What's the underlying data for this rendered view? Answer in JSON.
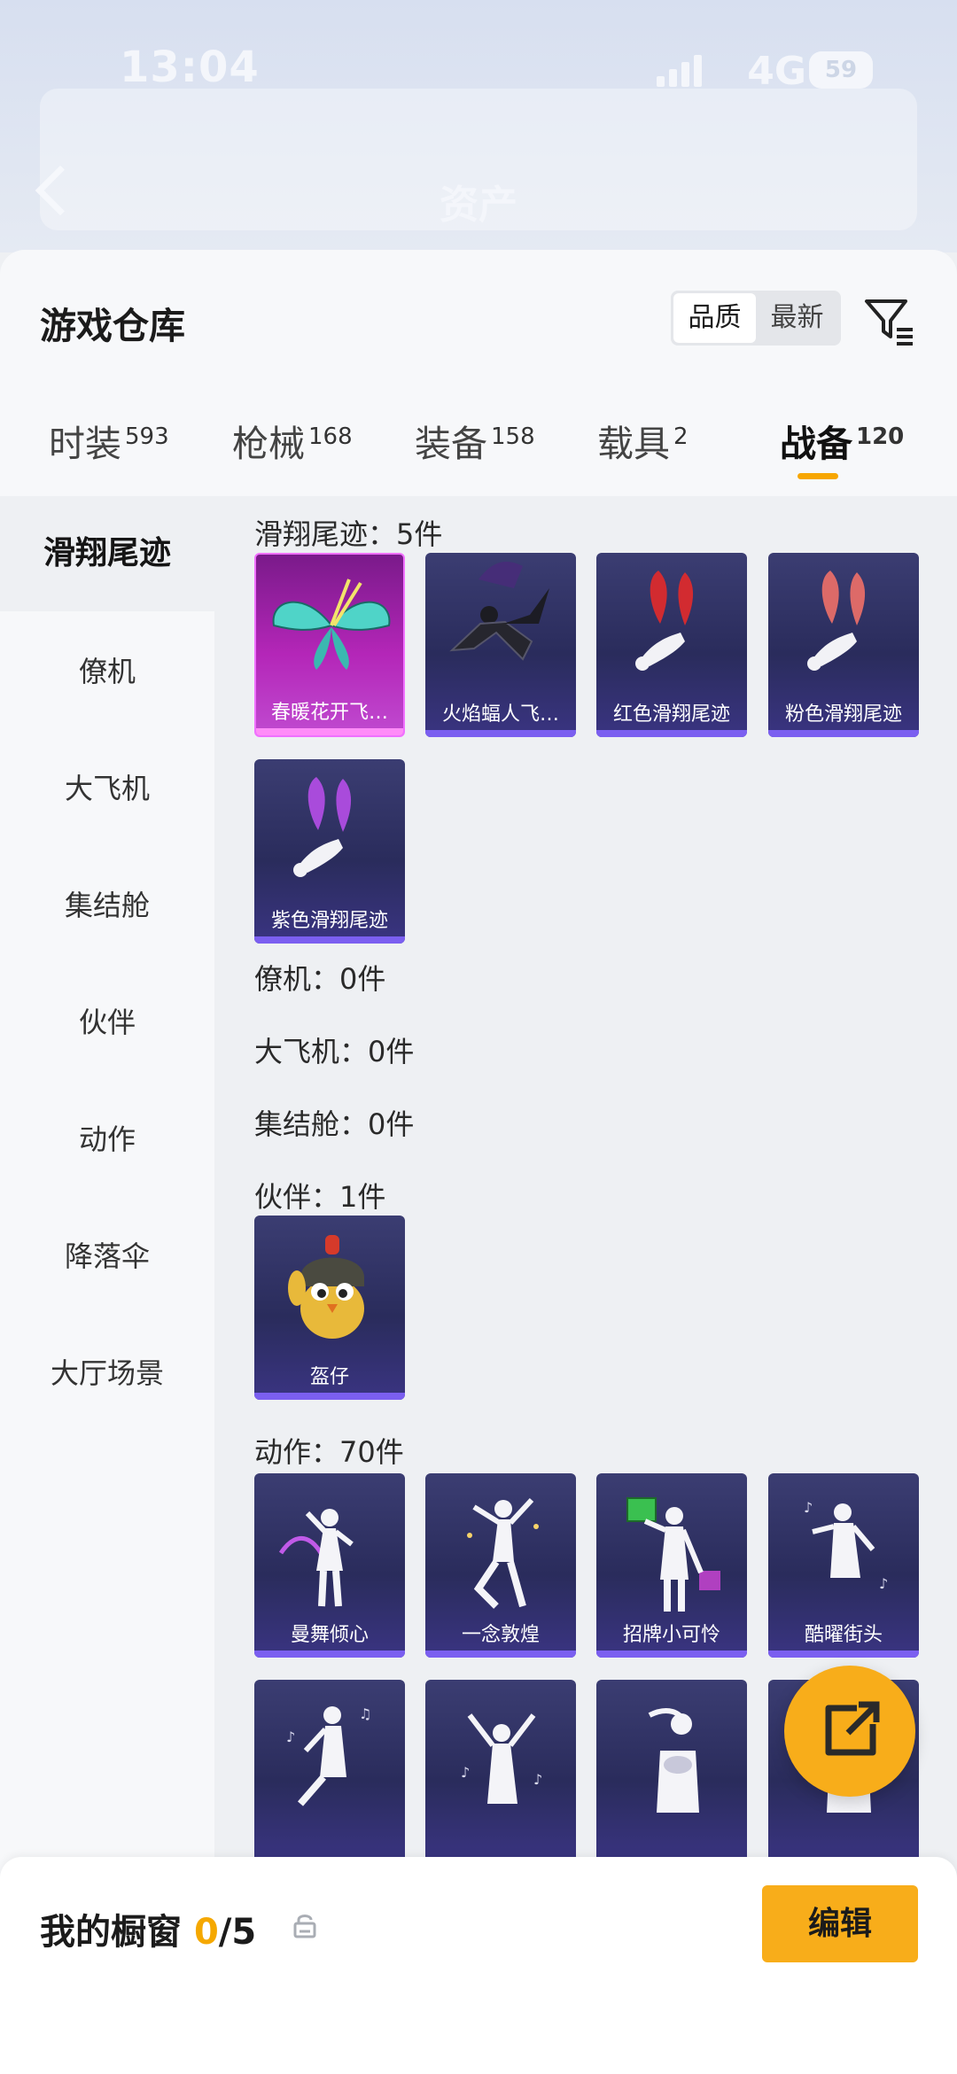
{
  "status_bar": {
    "time": "13:04",
    "network": "4G",
    "battery": "59"
  },
  "app_nav": {
    "title": "资产"
  },
  "header": {
    "title": "游戏仓库",
    "sort_options": [
      "品质",
      "最新"
    ]
  },
  "tabs": [
    {
      "label": "时装",
      "count": "593"
    },
    {
      "label": "枪械",
      "count": "168"
    },
    {
      "label": "装备",
      "count": "158"
    },
    {
      "label": "载具",
      "count": "2"
    },
    {
      "label": "战备",
      "count": "120"
    }
  ],
  "sidebar": {
    "items": [
      {
        "label": "滑翔尾迹"
      },
      {
        "label": "僚机"
      },
      {
        "label": "大飞机"
      },
      {
        "label": "集结舱"
      },
      {
        "label": "伙伴"
      },
      {
        "label": "动作"
      },
      {
        "label": "降落伞"
      },
      {
        "label": "大厅场景"
      }
    ]
  },
  "sections": {
    "glide_trail": {
      "title": "滑翔尾迹：5件",
      "items": [
        {
          "name": "春暖花开飞…"
        },
        {
          "name": "火焰蝠人飞…"
        },
        {
          "name": "红色滑翔尾迹"
        },
        {
          "name": "粉色滑翔尾迹"
        },
        {
          "name": "紫色滑翔尾迹"
        }
      ]
    },
    "wingman": {
      "title": "僚机：0件"
    },
    "big_plane": {
      "title": "大飞机：0件"
    },
    "pod": {
      "title": "集结舱：0件"
    },
    "companion": {
      "title": "伙伴：1件",
      "items": [
        {
          "name": "盔仔"
        }
      ]
    },
    "emote": {
      "title": "动作：70件",
      "items": [
        {
          "name": "曼舞倾心"
        },
        {
          "name": "一念敦煌"
        },
        {
          "name": "招牌小可怜"
        },
        {
          "name": "酷曜街头"
        },
        {
          "name": ""
        },
        {
          "name": ""
        },
        {
          "name": ""
        },
        {
          "name": ""
        }
      ]
    }
  },
  "showcase": {
    "label": "我的橱窗",
    "current": "0",
    "total": "/5",
    "edit_label": "编辑"
  },
  "colors": {
    "accent": "#f8ad1a",
    "count_highlight": "#f5a800"
  }
}
